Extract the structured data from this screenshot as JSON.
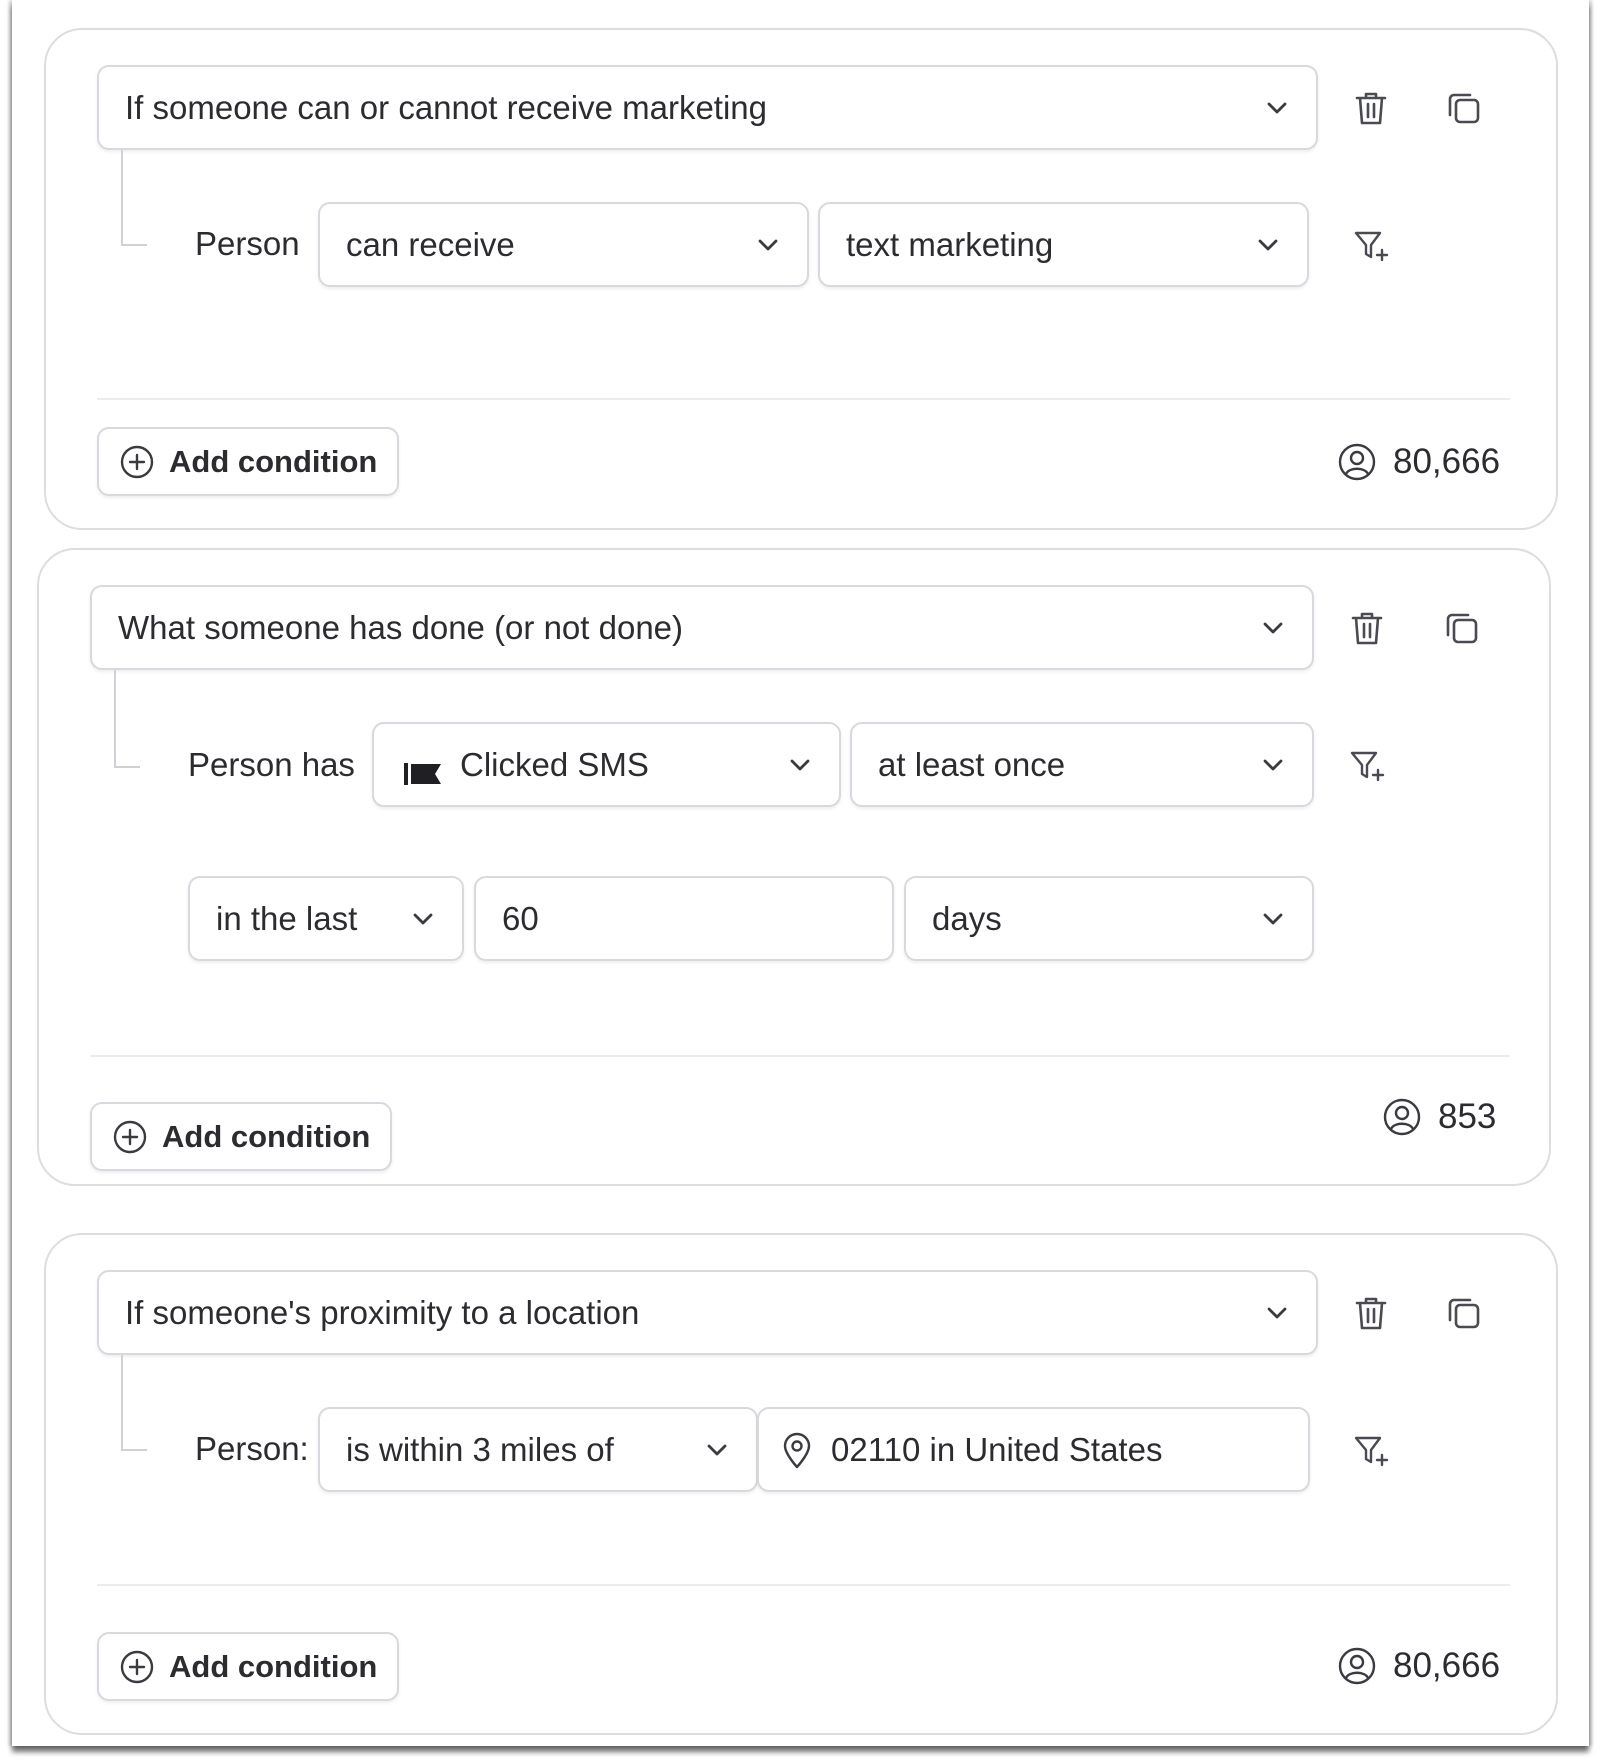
{
  "add_condition_label": "Add condition",
  "blocks": [
    {
      "title": "If someone can or cannot receive marketing",
      "subject": "Person",
      "field1": "can receive",
      "field2": "text marketing",
      "count": "80,666"
    },
    {
      "title": "What someone has done (or not done)",
      "subject": "Person has",
      "metric": "Clicked SMS",
      "frequency": "at least once",
      "timeframe": "in the last",
      "number": "60",
      "unit": "days",
      "count": "853"
    },
    {
      "title": "If someone's proximity to a location",
      "subject": "Person:",
      "field1": "is within 3 miles of",
      "location": "02110 in United States",
      "count": "80,666"
    }
  ],
  "colors": {
    "border": "#d8d8de",
    "text": "#2b2b30",
    "icon": "#4a4a52"
  }
}
